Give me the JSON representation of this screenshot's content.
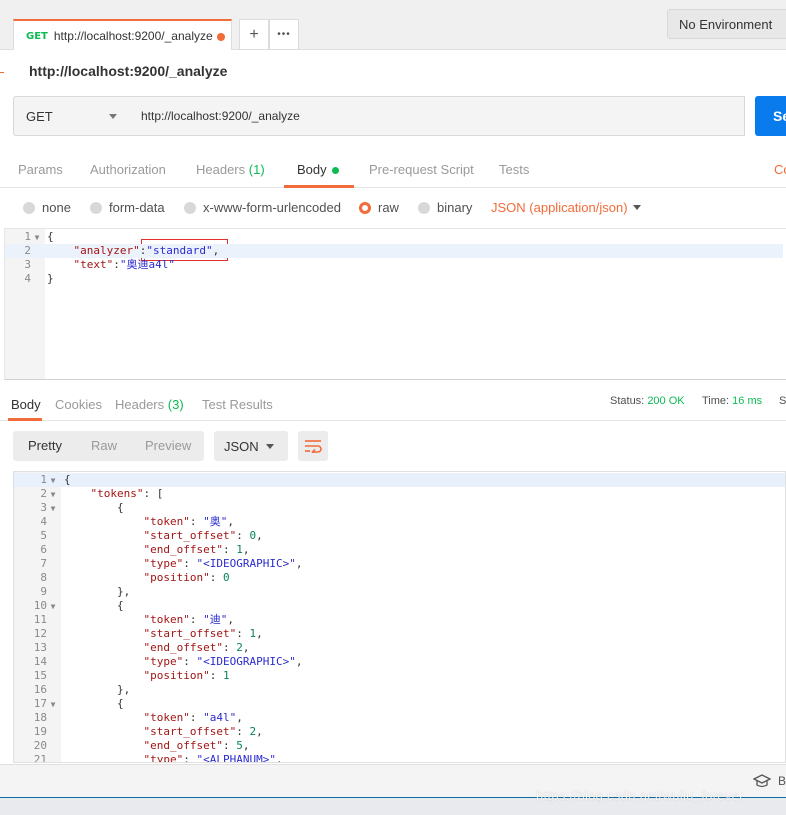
{
  "tabbar": {
    "tab_method": "GET",
    "tab_title": "http://localhost:9200/_analyze",
    "add_glyph": "+",
    "more_glyph": "•••",
    "environment": "No Environment"
  },
  "request": {
    "name": "http://localhost:9200/_analyze",
    "method": "GET",
    "url": "http://localhost:9200/_analyze",
    "send_label": "Se"
  },
  "request_tabs": {
    "params": "Params",
    "authorization": "Authorization",
    "headers": "Headers",
    "headers_count": "(1)",
    "body": "Body",
    "prerequest": "Pre-request Script",
    "tests": "Tests",
    "cookies_code": "Co"
  },
  "body_types": {
    "none": "none",
    "form_data": "form-data",
    "urlencoded": "x-www-form-urlencoded",
    "raw": "raw",
    "binary": "binary",
    "content_type": "JSON (application/json)",
    "selected": "raw"
  },
  "request_body": [
    {
      "n": "1",
      "fold": "▼",
      "parts": [
        {
          "c": "",
          "t": "{"
        }
      ]
    },
    {
      "n": "2",
      "fold": "",
      "parts": [
        {
          "c": "",
          "t": "    "
        },
        {
          "c": "k",
          "t": "\"analyzer\""
        },
        {
          "c": "",
          "t": ":"
        },
        {
          "c": "s",
          "t": "\"standard\""
        },
        {
          "c": "",
          "t": ","
        }
      ]
    },
    {
      "n": "3",
      "fold": "",
      "parts": [
        {
          "c": "",
          "t": "    "
        },
        {
          "c": "k",
          "t": "\"text\""
        },
        {
          "c": "",
          "t": ":"
        },
        {
          "c": "s",
          "t": "\"奥迪a4l\""
        }
      ]
    },
    {
      "n": "4",
      "fold": "",
      "parts": [
        {
          "c": "",
          "t": "}"
        }
      ]
    }
  ],
  "response_tabs": {
    "body": "Body",
    "cookies": "Cookies",
    "headers": "Headers",
    "headers_count": "(3)",
    "test_results": "Test Results",
    "status_label": "Status:",
    "status_value": "200 OK",
    "time_label": "Time:",
    "time_value": "16 ms",
    "size_label": "S"
  },
  "response_toolbar": {
    "pretty": "Pretty",
    "raw": "Raw",
    "preview": "Preview",
    "format": "JSON"
  },
  "response_body": [
    {
      "n": "1",
      "fold": "▼",
      "parts": [
        {
          "c": "",
          "t": "{"
        }
      ]
    },
    {
      "n": "2",
      "fold": "▼",
      "parts": [
        {
          "c": "",
          "t": "    "
        },
        {
          "c": "k",
          "t": "\"tokens\""
        },
        {
          "c": "",
          "t": ": ["
        }
      ]
    },
    {
      "n": "3",
      "fold": "▼",
      "parts": [
        {
          "c": "",
          "t": "        {"
        }
      ]
    },
    {
      "n": "4",
      "fold": "",
      "parts": [
        {
          "c": "",
          "t": "            "
        },
        {
          "c": "k",
          "t": "\"token\""
        },
        {
          "c": "",
          "t": ": "
        },
        {
          "c": "s",
          "t": "\"奥\""
        },
        {
          "c": "",
          "t": ","
        }
      ]
    },
    {
      "n": "5",
      "fold": "",
      "parts": [
        {
          "c": "",
          "t": "            "
        },
        {
          "c": "k",
          "t": "\"start_offset\""
        },
        {
          "c": "",
          "t": ": "
        },
        {
          "c": "n",
          "t": "0"
        },
        {
          "c": "",
          "t": ","
        }
      ]
    },
    {
      "n": "6",
      "fold": "",
      "parts": [
        {
          "c": "",
          "t": "            "
        },
        {
          "c": "k",
          "t": "\"end_offset\""
        },
        {
          "c": "",
          "t": ": "
        },
        {
          "c": "n",
          "t": "1"
        },
        {
          "c": "",
          "t": ","
        }
      ]
    },
    {
      "n": "7",
      "fold": "",
      "parts": [
        {
          "c": "",
          "t": "            "
        },
        {
          "c": "k",
          "t": "\"type\""
        },
        {
          "c": "",
          "t": ": "
        },
        {
          "c": "s",
          "t": "\"<IDEOGRAPHIC>\""
        },
        {
          "c": "",
          "t": ","
        }
      ]
    },
    {
      "n": "8",
      "fold": "",
      "parts": [
        {
          "c": "",
          "t": "            "
        },
        {
          "c": "k",
          "t": "\"position\""
        },
        {
          "c": "",
          "t": ": "
        },
        {
          "c": "n",
          "t": "0"
        }
      ]
    },
    {
      "n": "9",
      "fold": "",
      "parts": [
        {
          "c": "",
          "t": "        },"
        }
      ]
    },
    {
      "n": "10",
      "fold": "▼",
      "parts": [
        {
          "c": "",
          "t": "        {"
        }
      ]
    },
    {
      "n": "11",
      "fold": "",
      "parts": [
        {
          "c": "",
          "t": "            "
        },
        {
          "c": "k",
          "t": "\"token\""
        },
        {
          "c": "",
          "t": ": "
        },
        {
          "c": "s",
          "t": "\"迪\""
        },
        {
          "c": "",
          "t": ","
        }
      ]
    },
    {
      "n": "12",
      "fold": "",
      "parts": [
        {
          "c": "",
          "t": "            "
        },
        {
          "c": "k",
          "t": "\"start_offset\""
        },
        {
          "c": "",
          "t": ": "
        },
        {
          "c": "n",
          "t": "1"
        },
        {
          "c": "",
          "t": ","
        }
      ]
    },
    {
      "n": "13",
      "fold": "",
      "parts": [
        {
          "c": "",
          "t": "            "
        },
        {
          "c": "k",
          "t": "\"end_offset\""
        },
        {
          "c": "",
          "t": ": "
        },
        {
          "c": "n",
          "t": "2"
        },
        {
          "c": "",
          "t": ","
        }
      ]
    },
    {
      "n": "14",
      "fold": "",
      "parts": [
        {
          "c": "",
          "t": "            "
        },
        {
          "c": "k",
          "t": "\"type\""
        },
        {
          "c": "",
          "t": ": "
        },
        {
          "c": "s",
          "t": "\"<IDEOGRAPHIC>\""
        },
        {
          "c": "",
          "t": ","
        }
      ]
    },
    {
      "n": "15",
      "fold": "",
      "parts": [
        {
          "c": "",
          "t": "            "
        },
        {
          "c": "k",
          "t": "\"position\""
        },
        {
          "c": "",
          "t": ": "
        },
        {
          "c": "n",
          "t": "1"
        }
      ]
    },
    {
      "n": "16",
      "fold": "",
      "parts": [
        {
          "c": "",
          "t": "        },"
        }
      ]
    },
    {
      "n": "17",
      "fold": "▼",
      "parts": [
        {
          "c": "",
          "t": "        {"
        }
      ]
    },
    {
      "n": "18",
      "fold": "",
      "parts": [
        {
          "c": "",
          "t": "            "
        },
        {
          "c": "k",
          "t": "\"token\""
        },
        {
          "c": "",
          "t": ": "
        },
        {
          "c": "s",
          "t": "\"a4l\""
        },
        {
          "c": "",
          "t": ","
        }
      ]
    },
    {
      "n": "19",
      "fold": "",
      "parts": [
        {
          "c": "",
          "t": "            "
        },
        {
          "c": "k",
          "t": "\"start_offset\""
        },
        {
          "c": "",
          "t": ": "
        },
        {
          "c": "n",
          "t": "2"
        },
        {
          "c": "",
          "t": ","
        }
      ]
    },
    {
      "n": "20",
      "fold": "",
      "parts": [
        {
          "c": "",
          "t": "            "
        },
        {
          "c": "k",
          "t": "\"end_offset\""
        },
        {
          "c": "",
          "t": ": "
        },
        {
          "c": "n",
          "t": "5"
        },
        {
          "c": "",
          "t": ","
        }
      ]
    },
    {
      "n": "21",
      "fold": "",
      "parts": [
        {
          "c": "",
          "t": "            "
        },
        {
          "c": "k",
          "t": "\"type\""
        },
        {
          "c": "",
          "t": ": "
        },
        {
          "c": "s",
          "t": "\"<ALPHANUM>\""
        },
        {
          "c": "",
          "t": ","
        }
      ]
    }
  ],
  "bottombar": {
    "bootcamp_label": "B"
  },
  "watermark": "https://blog.csdn.net/wuliu_forever",
  "colors": {
    "accent": "#f26b3a",
    "send": "#097bed",
    "status_ok": "#0cbb52"
  }
}
